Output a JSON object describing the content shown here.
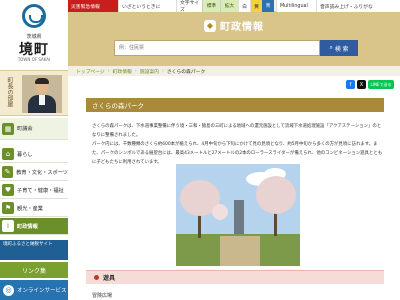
{
  "logo": {
    "prefecture": "茨城県",
    "town": "境町",
    "english": "TOWN OF SAKAI"
  },
  "mayor": {
    "label": "町長の部屋"
  },
  "sidebar": {
    "items": [
      {
        "label": "町議会",
        "icon": "building-icon",
        "icon_glyph": "▦"
      },
      {
        "label": "暮らし",
        "icon": "house-icon",
        "icon_glyph": "⌂"
      },
      {
        "label": "教育・文化・スポーツ",
        "icon": "book-icon",
        "icon_glyph": "✎"
      },
      {
        "label": "子育て・健康・福祉",
        "icon": "heart-icon",
        "icon_glyph": "♥"
      },
      {
        "label": "観光・産業",
        "icon": "flag-icon",
        "icon_glyph": "⚑"
      },
      {
        "label": "町政情報",
        "icon": "info-icon",
        "icon_glyph": "i"
      }
    ],
    "banner_text": "境町ふるさと納税サイト",
    "link_label": "リンク集",
    "online_label": "オンラインサービス"
  },
  "topbar": {
    "emergency": "災害緊急情報",
    "iza_label": "いざというときに",
    "sitemap": "文字サイズ",
    "reading": "標準",
    "zoom": "拡大",
    "color_white": "白",
    "color_yellow": "黄",
    "color_blue": "青",
    "language": "Multilingual",
    "voice": "音声読み上げ・ふりがな"
  },
  "header": {
    "section_title": "町政情報",
    "search_placeholder": "例：住民票",
    "search_button": "検 索"
  },
  "breadcrumb": [
    "トップページ",
    "町政情報",
    "施設案内",
    "さくらの森パーク"
  ],
  "share": {
    "line_label": "LINEで送る"
  },
  "page": {
    "title": "さくらの森パーク",
    "paragraph1": "さくらの森パークは、下水道事業整備に伴う境・三和・猿島の三町による地域への還元施設として流域下水道処理施設「アクアステーション」のとなりに整備されました。",
    "paragraph2": "パーク内には、千数種類のさくら約600本が植えられ、4月中旬から下旬にかけて見の見頃となり、約5月中旬から多くの方が見頃に訪れます。また、パークのシンボルである展望台には、最高43メートルと27メートルの2本のローラースライダーが備えられ、他のコンビネーション遊具とともに子どもたちに利用されています。",
    "equipment_heading": "遊具",
    "equipment_item": "冒険広場"
  },
  "colors": {
    "header_gold": "#d9c58a",
    "title_bar": "#a88a3a",
    "sidebar_green": "#6b8f2a",
    "emergency_red": "#c81e1e",
    "search_blue": "#2e5c9e"
  }
}
